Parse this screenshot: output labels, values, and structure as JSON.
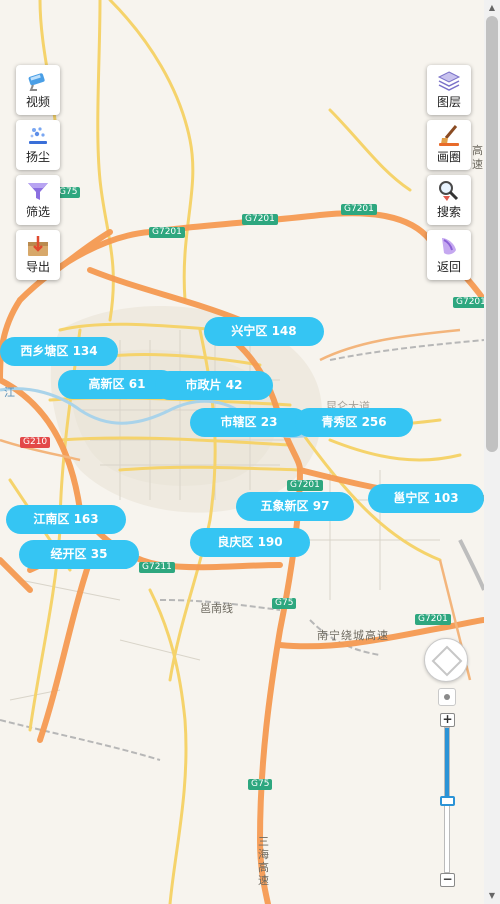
{
  "left_tools": [
    {
      "id": "video",
      "label": "视频",
      "icon": "camera-icon"
    },
    {
      "id": "dust",
      "label": "扬尘",
      "icon": "dust-icon"
    },
    {
      "id": "filter",
      "label": "筛选",
      "icon": "funnel-icon"
    },
    {
      "id": "export",
      "label": "导出",
      "icon": "export-box-icon"
    }
  ],
  "right_tools": [
    {
      "id": "layers",
      "label": "图层",
      "icon": "layers-icon"
    },
    {
      "id": "draw-circle",
      "label": "画圈",
      "icon": "brush-icon"
    },
    {
      "id": "search",
      "label": "搜索",
      "icon": "magnifier-icon"
    },
    {
      "id": "back",
      "label": "返回",
      "icon": "back-icon"
    }
  ],
  "districts": [
    {
      "name": "兴宁区",
      "count": "148"
    },
    {
      "name": "西乡塘区",
      "count": "134"
    },
    {
      "name": "高新区",
      "count": "61"
    },
    {
      "name": "市政片",
      "count": "42"
    },
    {
      "name": "市辖区",
      "count": "23"
    },
    {
      "name": "青秀区",
      "count": "256"
    },
    {
      "name": "五象新区",
      "count": "97"
    },
    {
      "name": "邕宁区",
      "count": "103"
    },
    {
      "name": "江南区",
      "count": "163"
    },
    {
      "name": "良庆区",
      "count": "190"
    },
    {
      "name": "经开区",
      "count": "35"
    }
  ],
  "road_labels": {
    "g7201_a": "G7201",
    "g7201_b": "G7201",
    "g7201_c": "G7201",
    "g7201_d": "G7201",
    "g7201_e": "G7201",
    "g7201_f": "G7201",
    "g7211": "G7211",
    "g75_a": "G75",
    "g75_b": "G75",
    "g75_c": "G75",
    "g210": "G210"
  },
  "map_texts": {
    "nanning_ring": "南宁绕城高速",
    "yongnan_line": "邕南线",
    "sanhai_expressway": "三海高速",
    "right_edge_gao": "高",
    "right_edge_su": "速",
    "left_edge_jiang": "江",
    "kunlun_road": "昆仑大道"
  },
  "map_controls": {
    "zoom_in": "+",
    "zoom_out": "−",
    "zoom_level_fraction": 0.49
  },
  "scrollbar": {
    "up": "▲",
    "down": "▼"
  },
  "colors": {
    "pill": "#35c5f3",
    "expressway": "#f59a52",
    "main_road": "#f5d36b",
    "national_road_badge": "#2ea77f"
  }
}
